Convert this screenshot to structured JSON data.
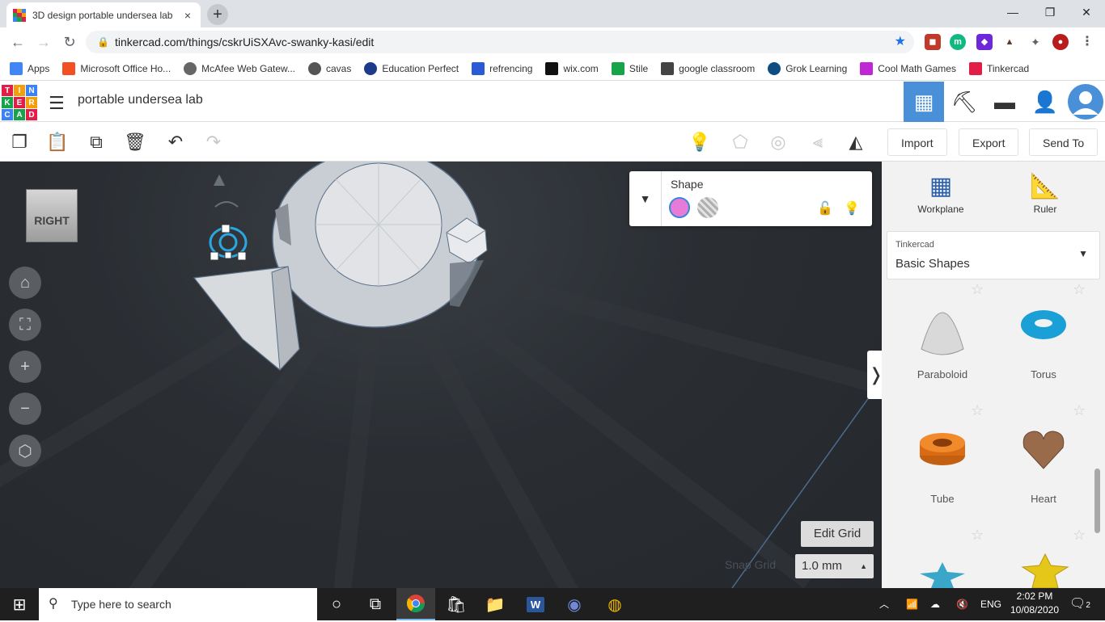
{
  "browser": {
    "tab_title": "3D design portable undersea lab",
    "close_glyph": "×",
    "new_tab_glyph": "+",
    "url": "tinkercad.com/things/cskrUiSXAvc-swanky-kasi/edit",
    "window_controls": {
      "minimize": "—",
      "maximize": "❐",
      "close": "✕"
    }
  },
  "bookmarks": [
    {
      "label": "Apps",
      "color": "#4285f4"
    },
    {
      "label": "Microsoft Office Ho...",
      "color": "#f25022"
    },
    {
      "label": "McAfee Web Gatew...",
      "color": "#666666"
    },
    {
      "label": "cavas",
      "color": "#555555"
    },
    {
      "label": "Education Perfect",
      "color": "#1e3a8a"
    },
    {
      "label": "refrencing",
      "color": "#2a5bd7"
    },
    {
      "label": "wix.com",
      "color": "#111111"
    },
    {
      "label": "Stile",
      "color": "#16a34a"
    },
    {
      "label": "google classroom",
      "color": "#444444"
    },
    {
      "label": "Grok Learning",
      "color": "#0f4c81"
    },
    {
      "label": "Cool Math Games",
      "color": "#c026d3"
    },
    {
      "label": "Tinkercad",
      "color": "#e11d48"
    }
  ],
  "tinkercad": {
    "logo_letters": [
      "T",
      "I",
      "N",
      "K",
      "E",
      "R",
      "C",
      "A",
      "D"
    ],
    "project_name": "portable undersea lab",
    "toolbar": {
      "import": "Import",
      "export": "Export",
      "send_to": "Send To"
    },
    "shape_panel": {
      "title": "Shape",
      "solid_color": "#e87ad8"
    },
    "view_cube_label": "RIGHT",
    "edit_grid": "Edit Grid",
    "snap_grid_label": "Snap Grid",
    "snap_grid_value": "1.0 mm",
    "sidebar": {
      "workplane": "Workplane",
      "ruler": "Ruler",
      "library_source": "Tinkercad",
      "library_name": "Basic Shapes",
      "shapes": [
        {
          "label": "Paraboloid"
        },
        {
          "label": "Torus"
        },
        {
          "label": "Tube"
        },
        {
          "label": "Heart"
        }
      ]
    }
  },
  "taskbar": {
    "search_placeholder": "Type here to search",
    "language": "ENG",
    "time": "2:02 PM",
    "date": "10/08/2020",
    "notification_count": "2"
  }
}
